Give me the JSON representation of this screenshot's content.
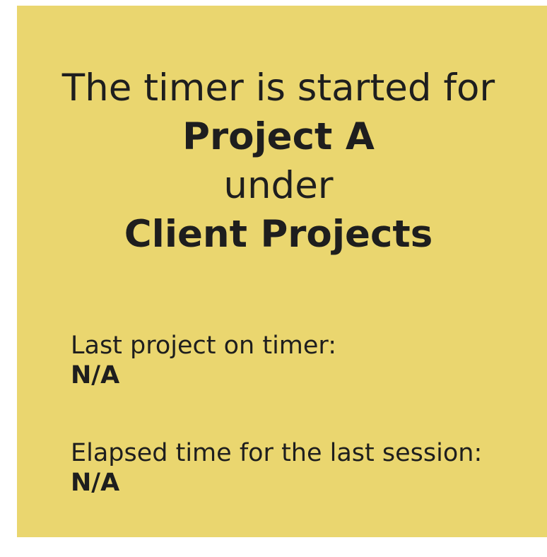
{
  "timer_card": {
    "line_1": "The timer is started for",
    "project_name": "Project A",
    "line_3": "under",
    "client_name": "Client Projects",
    "last_project_label": "Last project on timer:",
    "last_project_value": "N/A",
    "elapsed_label": "Elapsed time for the last session:",
    "elapsed_value": "N/A"
  },
  "colors": {
    "card_background": "#ead66f",
    "text": "#1e1e1e",
    "page_background": "#ffffff"
  }
}
